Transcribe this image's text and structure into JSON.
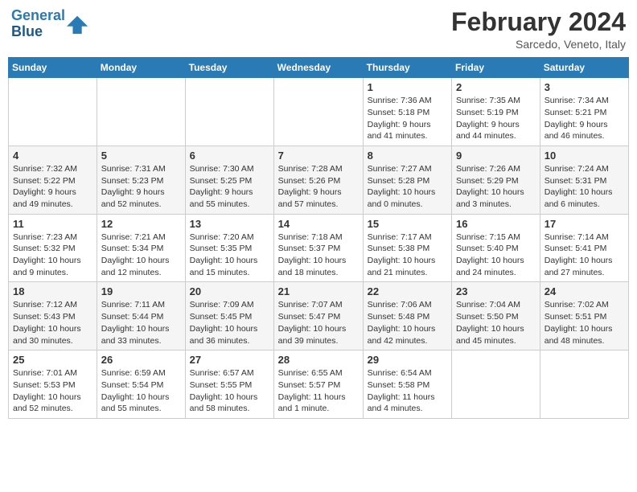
{
  "header": {
    "logo_line1": "General",
    "logo_line2": "Blue",
    "month_year": "February 2024",
    "location": "Sarcedo, Veneto, Italy"
  },
  "days_of_week": [
    "Sunday",
    "Monday",
    "Tuesday",
    "Wednesday",
    "Thursday",
    "Friday",
    "Saturday"
  ],
  "weeks": [
    [
      {
        "day": "",
        "info": ""
      },
      {
        "day": "",
        "info": ""
      },
      {
        "day": "",
        "info": ""
      },
      {
        "day": "",
        "info": ""
      },
      {
        "day": "1",
        "info": "Sunrise: 7:36 AM\nSunset: 5:18 PM\nDaylight: 9 hours\nand 41 minutes."
      },
      {
        "day": "2",
        "info": "Sunrise: 7:35 AM\nSunset: 5:19 PM\nDaylight: 9 hours\nand 44 minutes."
      },
      {
        "day": "3",
        "info": "Sunrise: 7:34 AM\nSunset: 5:21 PM\nDaylight: 9 hours\nand 46 minutes."
      }
    ],
    [
      {
        "day": "4",
        "info": "Sunrise: 7:32 AM\nSunset: 5:22 PM\nDaylight: 9 hours\nand 49 minutes."
      },
      {
        "day": "5",
        "info": "Sunrise: 7:31 AM\nSunset: 5:23 PM\nDaylight: 9 hours\nand 52 minutes."
      },
      {
        "day": "6",
        "info": "Sunrise: 7:30 AM\nSunset: 5:25 PM\nDaylight: 9 hours\nand 55 minutes."
      },
      {
        "day": "7",
        "info": "Sunrise: 7:28 AM\nSunset: 5:26 PM\nDaylight: 9 hours\nand 57 minutes."
      },
      {
        "day": "8",
        "info": "Sunrise: 7:27 AM\nSunset: 5:28 PM\nDaylight: 10 hours\nand 0 minutes."
      },
      {
        "day": "9",
        "info": "Sunrise: 7:26 AM\nSunset: 5:29 PM\nDaylight: 10 hours\nand 3 minutes."
      },
      {
        "day": "10",
        "info": "Sunrise: 7:24 AM\nSunset: 5:31 PM\nDaylight: 10 hours\nand 6 minutes."
      }
    ],
    [
      {
        "day": "11",
        "info": "Sunrise: 7:23 AM\nSunset: 5:32 PM\nDaylight: 10 hours\nand 9 minutes."
      },
      {
        "day": "12",
        "info": "Sunrise: 7:21 AM\nSunset: 5:34 PM\nDaylight: 10 hours\nand 12 minutes."
      },
      {
        "day": "13",
        "info": "Sunrise: 7:20 AM\nSunset: 5:35 PM\nDaylight: 10 hours\nand 15 minutes."
      },
      {
        "day": "14",
        "info": "Sunrise: 7:18 AM\nSunset: 5:37 PM\nDaylight: 10 hours\nand 18 minutes."
      },
      {
        "day": "15",
        "info": "Sunrise: 7:17 AM\nSunset: 5:38 PM\nDaylight: 10 hours\nand 21 minutes."
      },
      {
        "day": "16",
        "info": "Sunrise: 7:15 AM\nSunset: 5:40 PM\nDaylight: 10 hours\nand 24 minutes."
      },
      {
        "day": "17",
        "info": "Sunrise: 7:14 AM\nSunset: 5:41 PM\nDaylight: 10 hours\nand 27 minutes."
      }
    ],
    [
      {
        "day": "18",
        "info": "Sunrise: 7:12 AM\nSunset: 5:43 PM\nDaylight: 10 hours\nand 30 minutes."
      },
      {
        "day": "19",
        "info": "Sunrise: 7:11 AM\nSunset: 5:44 PM\nDaylight: 10 hours\nand 33 minutes."
      },
      {
        "day": "20",
        "info": "Sunrise: 7:09 AM\nSunset: 5:45 PM\nDaylight: 10 hours\nand 36 minutes."
      },
      {
        "day": "21",
        "info": "Sunrise: 7:07 AM\nSunset: 5:47 PM\nDaylight: 10 hours\nand 39 minutes."
      },
      {
        "day": "22",
        "info": "Sunrise: 7:06 AM\nSunset: 5:48 PM\nDaylight: 10 hours\nand 42 minutes."
      },
      {
        "day": "23",
        "info": "Sunrise: 7:04 AM\nSunset: 5:50 PM\nDaylight: 10 hours\nand 45 minutes."
      },
      {
        "day": "24",
        "info": "Sunrise: 7:02 AM\nSunset: 5:51 PM\nDaylight: 10 hours\nand 48 minutes."
      }
    ],
    [
      {
        "day": "25",
        "info": "Sunrise: 7:01 AM\nSunset: 5:53 PM\nDaylight: 10 hours\nand 52 minutes."
      },
      {
        "day": "26",
        "info": "Sunrise: 6:59 AM\nSunset: 5:54 PM\nDaylight: 10 hours\nand 55 minutes."
      },
      {
        "day": "27",
        "info": "Sunrise: 6:57 AM\nSunset: 5:55 PM\nDaylight: 10 hours\nand 58 minutes."
      },
      {
        "day": "28",
        "info": "Sunrise: 6:55 AM\nSunset: 5:57 PM\nDaylight: 11 hours\nand 1 minute."
      },
      {
        "day": "29",
        "info": "Sunrise: 6:54 AM\nSunset: 5:58 PM\nDaylight: 11 hours\nand 4 minutes."
      },
      {
        "day": "",
        "info": ""
      },
      {
        "day": "",
        "info": ""
      }
    ]
  ]
}
